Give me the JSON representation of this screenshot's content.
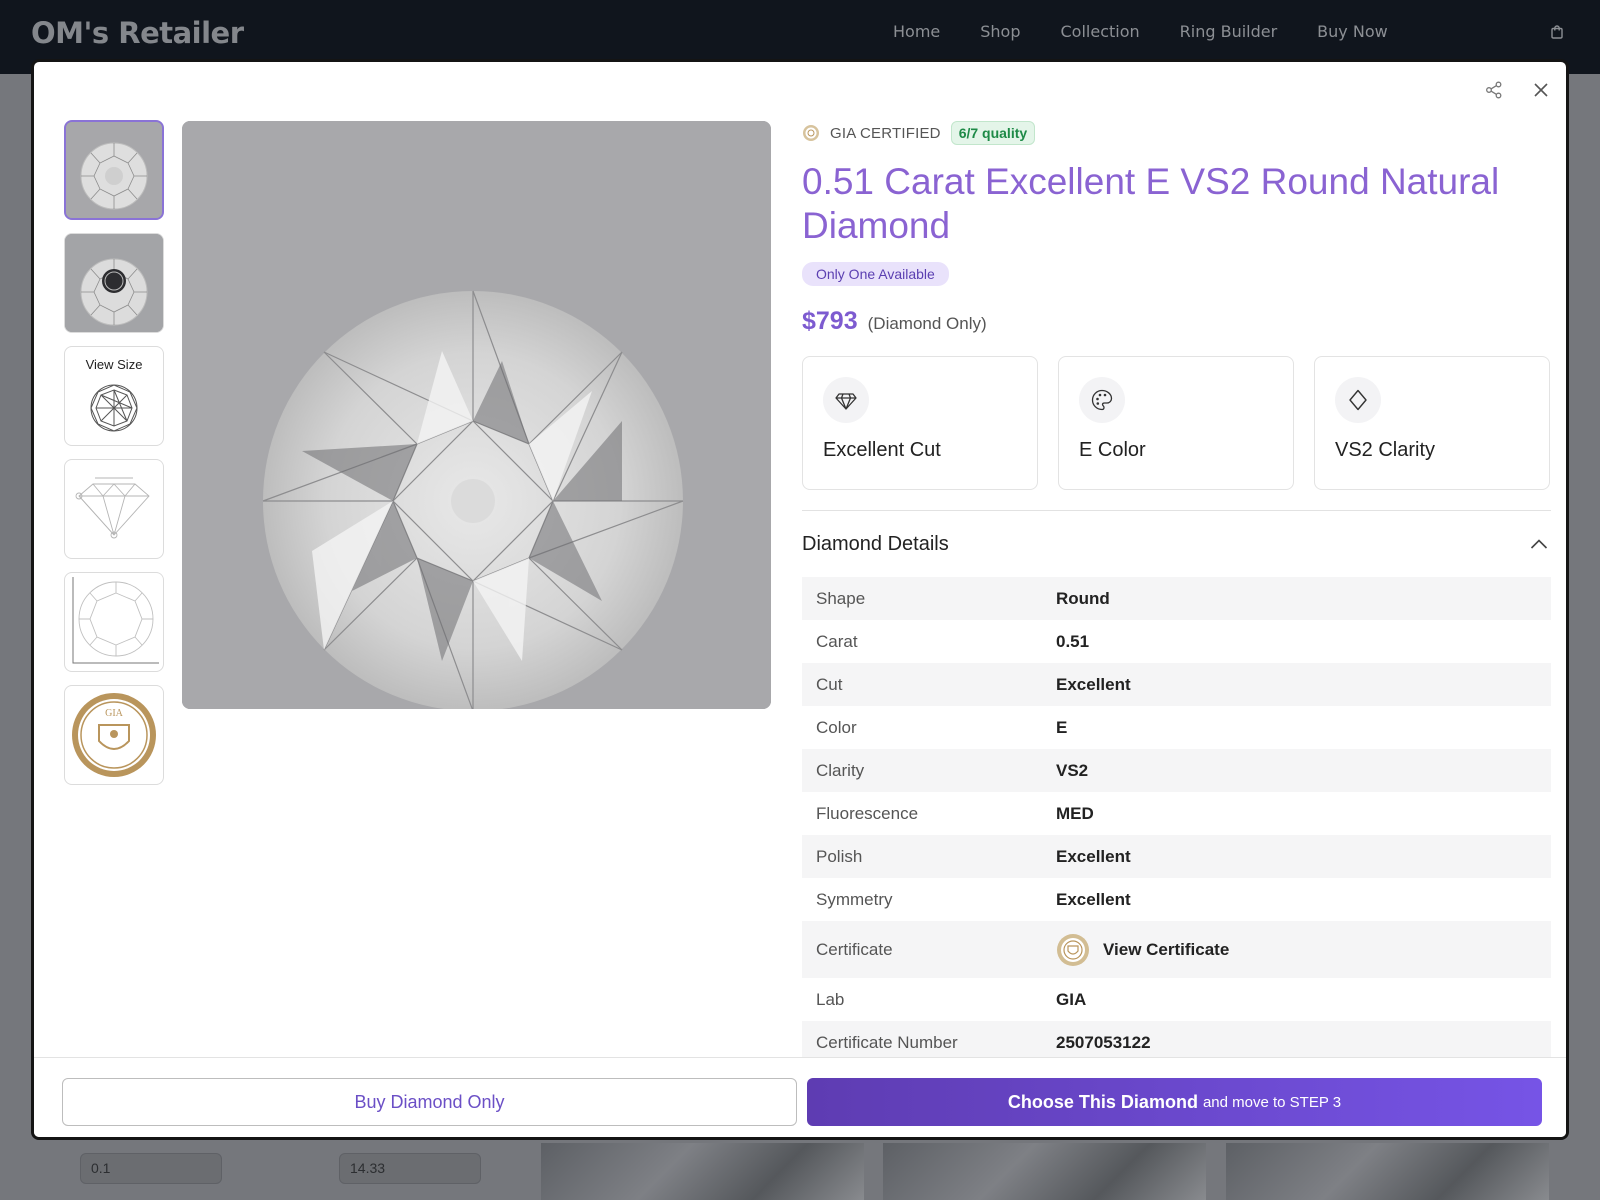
{
  "topbar": {
    "brand": "OM's Retailer",
    "nav": [
      "Home",
      "Shop",
      "Collection",
      "Ring Builder",
      "Buy Now"
    ]
  },
  "background": {
    "inputs": [
      "0.1",
      "14.33"
    ]
  },
  "gallery": {
    "view_size_label": "View Size",
    "gia_seal_text": "GIA"
  },
  "product": {
    "cert_label": "GIA CERTIFIED",
    "quality_badge": "6/7 quality",
    "title": "0.51 Carat Excellent E VS2 Round Natural Diamond",
    "availability": "Only One Available",
    "price": "$793",
    "price_note": "(Diamond Only)",
    "specs": [
      {
        "label": "Excellent Cut",
        "icon": "diamond-icon"
      },
      {
        "label": "E Color",
        "icon": "palette-icon"
      },
      {
        "label": "VS2 Clarity",
        "icon": "rhombus-icon"
      }
    ]
  },
  "details": {
    "title": "Diamond Details",
    "rows": [
      {
        "label": "Shape",
        "value": "Round"
      },
      {
        "label": "Carat",
        "value": "0.51"
      },
      {
        "label": "Cut",
        "value": "Excellent"
      },
      {
        "label": "Color",
        "value": "E"
      },
      {
        "label": "Clarity",
        "value": "VS2"
      },
      {
        "label": "Fluorescence",
        "value": "MED"
      },
      {
        "label": "Polish",
        "value": "Excellent"
      },
      {
        "label": "Symmetry",
        "value": "Excellent"
      },
      {
        "label": "Certificate",
        "value": "View Certificate"
      },
      {
        "label": "Lab",
        "value": "GIA"
      },
      {
        "label": "Certificate Number",
        "value": "2507053122"
      }
    ]
  },
  "footer": {
    "buy_only": "Buy Diamond Only",
    "choose_main": "Choose This Diamond",
    "choose_sub": "and move to STEP 3"
  },
  "colors": {
    "accent": "#8a63d2",
    "button": "#6a48d0",
    "quality_green": "#1e8a47"
  }
}
